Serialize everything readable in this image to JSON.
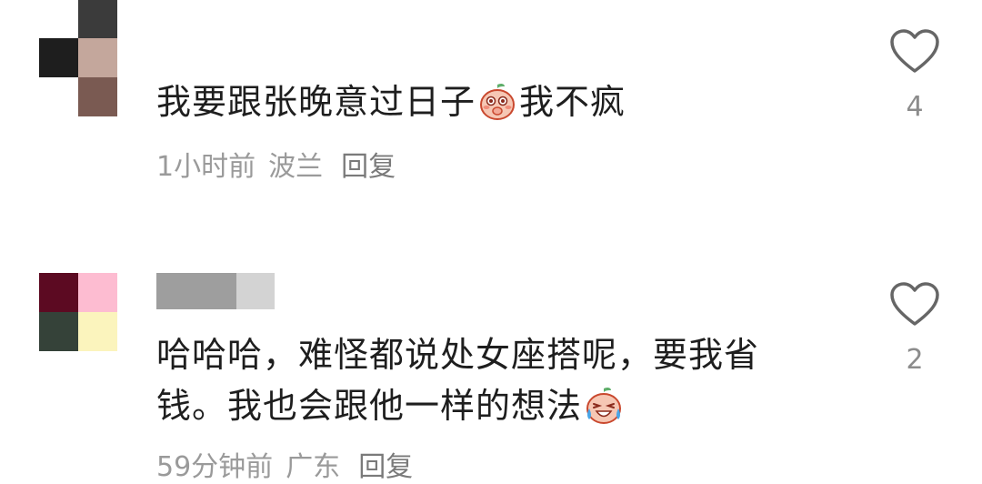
{
  "comments": [
    {
      "text_before_emoji": "我要跟张晚意过日子",
      "emoji_1": "blushing-peach-emoji",
      "text_after_emoji": "我不疯",
      "time": "1小时前",
      "location": "波兰",
      "reply_label": "回复",
      "like_count": "4",
      "avatar_colors": [
        "#3b3b3b",
        "#ffffff",
        "#1e1e1e",
        "#c4a79c",
        "#ffffff",
        "#7a5a52"
      ]
    },
    {
      "text_line_1": "哈哈哈，难怪都说处女座搭呢，要我省",
      "text_line_2": "钱。我也会跟他一样的想法",
      "emoji_2": "laughing-tears-peach-emoji",
      "time": "59分钟前",
      "location": "广东",
      "reply_label": "回复",
      "like_count": "2",
      "avatar_colors": [
        "#5c0a22",
        "#fdbcd1",
        "#354239",
        "#fbf4bd"
      ]
    }
  ],
  "icons": {
    "like": "heart-outline-icon"
  },
  "colors": {
    "meta_text": "#9a9a9a",
    "body_text": "#1e1e1e",
    "icon_stroke": "#666666"
  }
}
